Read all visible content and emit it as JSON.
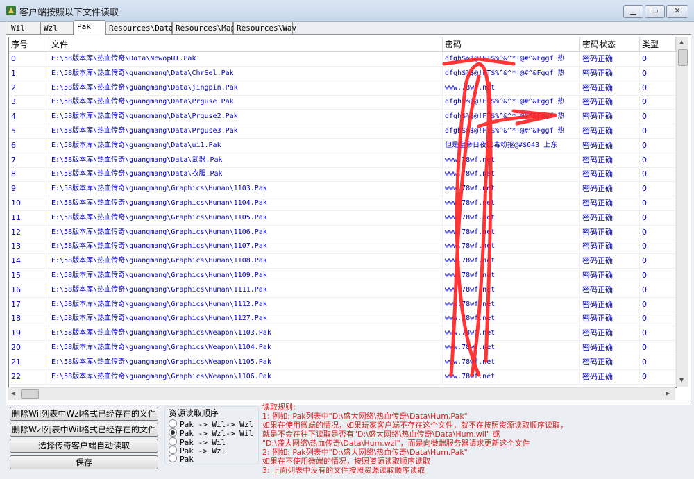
{
  "window": {
    "title": "客户端按照以下文件读取"
  },
  "tabs": [
    "Wil",
    "Wzl",
    "Pak",
    "Resources\\Data",
    "Resources\\Map",
    "Resources\\Wav"
  ],
  "active_tab": 2,
  "table": {
    "headers": [
      "序号",
      "文件",
      "密码",
      "密码状态",
      "类型"
    ],
    "rows": [
      [
        "0",
        "E:\\58版本库\\热血传奇\\Data\\NewopUI.Pak",
        "dfgh$%$@!FT$%^&^*!@#^&Fggf  热",
        "密码正确",
        "0"
      ],
      [
        "1",
        "E:\\58版本库\\热血传奇\\guangmang\\Data\\ChrSel.Pak",
        "dfgh$%$@!FT$%^&^*!@#^&Fggf  热",
        "密码正确",
        "0"
      ],
      [
        "2",
        "E:\\58版本库\\热血传奇\\guangmang\\Data\\jingpin.Pak",
        "www.78wf.net",
        "密码正确",
        "0"
      ],
      [
        "3",
        "E:\\58版本库\\热血传奇\\guangmang\\Data\\Prguse.Pak",
        "dfgh$%$@!FT$%^&^*!@#^&Fggf  热",
        "密码正确",
        "0"
      ],
      [
        "4",
        "E:\\58版本库\\热血传奇\\guangmang\\Data\\Prguse2.Pak",
        "dfgh$%$@!FT$%^&^*!@#^&Fggf  热",
        "密码正确",
        "0"
      ],
      [
        "5",
        "E:\\58版本库\\热血传奇\\guangmang\\Data\\Prguse3.Pak",
        "dfgh$%$@!FT$%^&^*!@#^&Fggf  热",
        "密码正确",
        "0"
      ],
      [
        "6",
        "E:\\58版本库\\热血传奇\\guangmang\\Data\\ui1.Pak",
        "但是皇帝日夜巴毒粉抠@#$643  上东",
        "密码正确",
        "0"
      ],
      [
        "7",
        "E:\\58版本库\\热血传奇\\guangmang\\Data\\武器.Pak",
        "www.78wf.net",
        "密码正确",
        "0"
      ],
      [
        "8",
        "E:\\58版本库\\热血传奇\\guangmang\\Data\\衣服.Pak",
        "www.78wf.net",
        "密码正确",
        "0"
      ],
      [
        "9",
        "E:\\58版本库\\热血传奇\\guangmang\\Graphics\\Human\\1103.Pak",
        "www.78wf.net",
        "密码正确",
        "0"
      ],
      [
        "10",
        "E:\\58版本库\\热血传奇\\guangmang\\Graphics\\Human\\1104.Pak",
        "www.78wf.net",
        "密码正确",
        "0"
      ],
      [
        "11",
        "E:\\58版本库\\热血传奇\\guangmang\\Graphics\\Human\\1105.Pak",
        "www.78wf.net",
        "密码正确",
        "0"
      ],
      [
        "12",
        "E:\\58版本库\\热血传奇\\guangmang\\Graphics\\Human\\1106.Pak",
        "www.78wf.net",
        "密码正确",
        "0"
      ],
      [
        "13",
        "E:\\58版本库\\热血传奇\\guangmang\\Graphics\\Human\\1107.Pak",
        "www.78wf.net",
        "密码正确",
        "0"
      ],
      [
        "14",
        "E:\\58版本库\\热血传奇\\guangmang\\Graphics\\Human\\1108.Pak",
        "www.78wf.net",
        "密码正确",
        "0"
      ],
      [
        "15",
        "E:\\58版本库\\热血传奇\\guangmang\\Graphics\\Human\\1109.Pak",
        "www.78wf.net",
        "密码正确",
        "0"
      ],
      [
        "16",
        "E:\\58版本库\\热血传奇\\guangmang\\Graphics\\Human\\1111.Pak",
        "www.78wf.net",
        "密码正确",
        "0"
      ],
      [
        "17",
        "E:\\58版本库\\热血传奇\\guangmang\\Graphics\\Human\\1112.Pak",
        "www.78wf.net",
        "密码正确",
        "0"
      ],
      [
        "18",
        "E:\\58版本库\\热血传奇\\guangmang\\Graphics\\Human\\1127.Pak",
        "www.78wf.net",
        "密码正确",
        "0"
      ],
      [
        "19",
        "E:\\58版本库\\热血传奇\\guangmang\\Graphics\\Weapon\\1103.Pak",
        "www.78wf.net",
        "密码正确",
        "0"
      ],
      [
        "20",
        "E:\\58版本库\\热血传奇\\guangmang\\Graphics\\Weapon\\1104.Pak",
        "www.78wf.net",
        "密码正确",
        "0"
      ],
      [
        "21",
        "E:\\58版本库\\热血传奇\\guangmang\\Graphics\\Weapon\\1105.Pak",
        "www.78wf.net",
        "密码正确",
        "0"
      ],
      [
        "22",
        "E:\\58版本库\\热血传奇\\guangmang\\Graphics\\Weapon\\1106.Pak",
        "www.78wf.net",
        "密码正确",
        "0"
      ]
    ]
  },
  "buttons": {
    "delete_wzl": "删除Wil列表中Wzl格式已经存在的义件",
    "delete_wil": "删除Wzl列表中Wil格式已经存在的文件",
    "auto_read": "选择传奇客户端自动读取",
    "save": "保存"
  },
  "read_order": {
    "title": "资源读取顺序",
    "options": [
      "Pak -> Wil-> Wzl",
      "Pak -> Wzl-> Wil",
      "Pak -> Wil",
      "Pak -> Wzl",
      "Pak"
    ],
    "selected": 1
  },
  "rules": [
    "读取规则:",
    "1: 例如: Pak列表中\"D:\\盛大网络\\热血传奇\\Data\\Hum.Pak\"",
    "    如果在使用微端的情况，如果玩家客户端不存在这个文件，就不在按照资源读取顺序读取，",
    "    就是不会在往下读取是否有\"D:\\盛大网络\\热血传奇\\Data\\Hum.wil\" 或",
    "    \"D:\\盛大网络\\热血传奇\\Data\\Hum.wzl\"，而是向微端服务器请求更新这个文件",
    "2: 例如: Pak列表中\"D:\\盛大网络\\热血传奇\\Data\\Hum.Pak\"",
    "    如果在不使用微端的情况，按照资源读取顺序读取",
    "3: 上面列表中没有的文件按照资源读取顺序读取"
  ],
  "colors": {
    "text_blue": "#0000c0",
    "rules_red": "#e02020",
    "scribble_red": "#ff2020"
  }
}
